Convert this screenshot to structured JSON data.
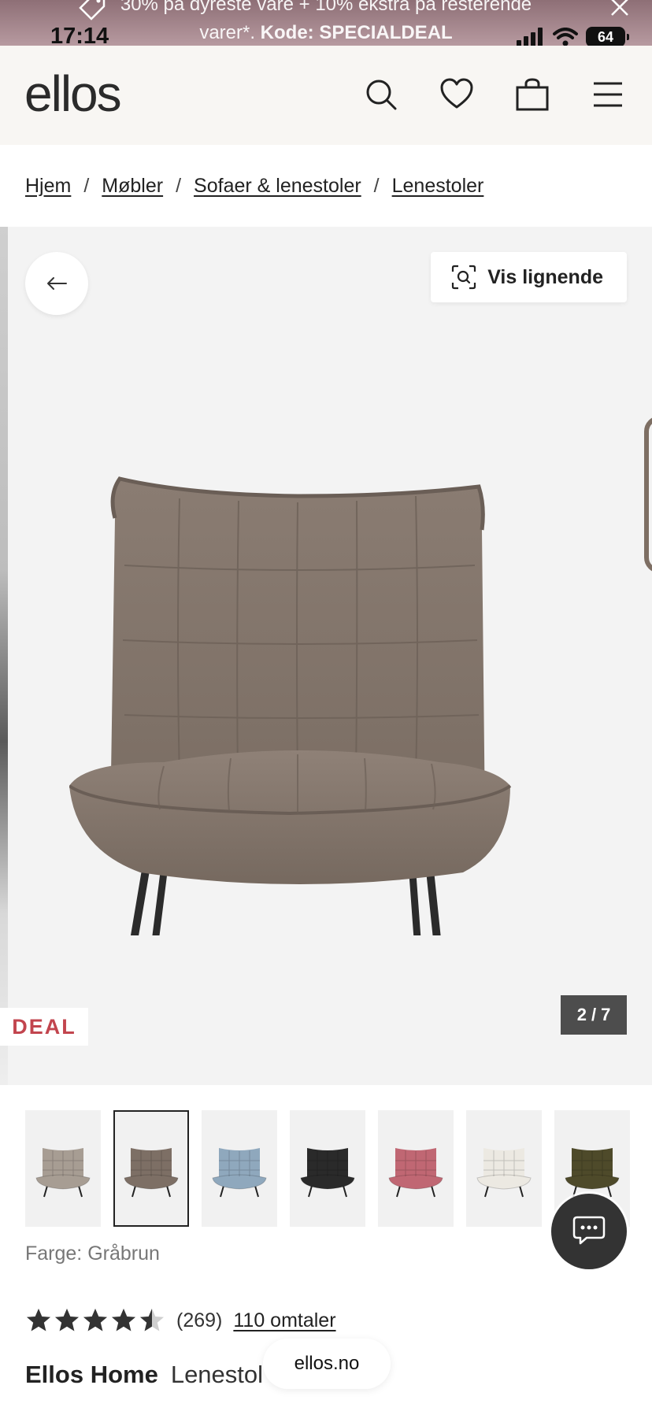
{
  "status_bar": {
    "time": "17:14",
    "battery": "64"
  },
  "promo": {
    "line1": "30% på dyreste vare + 10% ekstra på resterende",
    "line2_plain": "varer*. ",
    "line2_bold": "Kode: SPECIALDEAL"
  },
  "header": {
    "logo": "ellos"
  },
  "breadcrumb": {
    "items": [
      "Hjem",
      "Møbler",
      "Sofaer & lenestoler",
      "Lenestoler"
    ],
    "separator": "/"
  },
  "gallery": {
    "similar_label": "Vis lignende",
    "badge": "DEAL",
    "counter_current": "2",
    "counter_sep": "/",
    "counter_total": "7"
  },
  "thumbnails": [
    {
      "color": "#a79d93",
      "active": false
    },
    {
      "color": "#7d6f65",
      "active": true
    },
    {
      "color": "#8fa8bd",
      "active": false
    },
    {
      "color": "#2a2a2a",
      "active": false
    },
    {
      "color": "#c06773",
      "active": false
    },
    {
      "color": "#ece9e2",
      "active": false
    },
    {
      "color": "#4e4a2a",
      "active": false
    }
  ],
  "product": {
    "color_label": "Farge: Gråbrun",
    "rating_value": 4.5,
    "rating_count": "(269)",
    "reviews_link": "110 omtaler",
    "brand": "Ellos Home",
    "title": "Lenestol"
  },
  "browser": {
    "url": "ellos.no"
  },
  "colors": {
    "deal_red": "#c2454e",
    "accent_dark": "#222222"
  }
}
